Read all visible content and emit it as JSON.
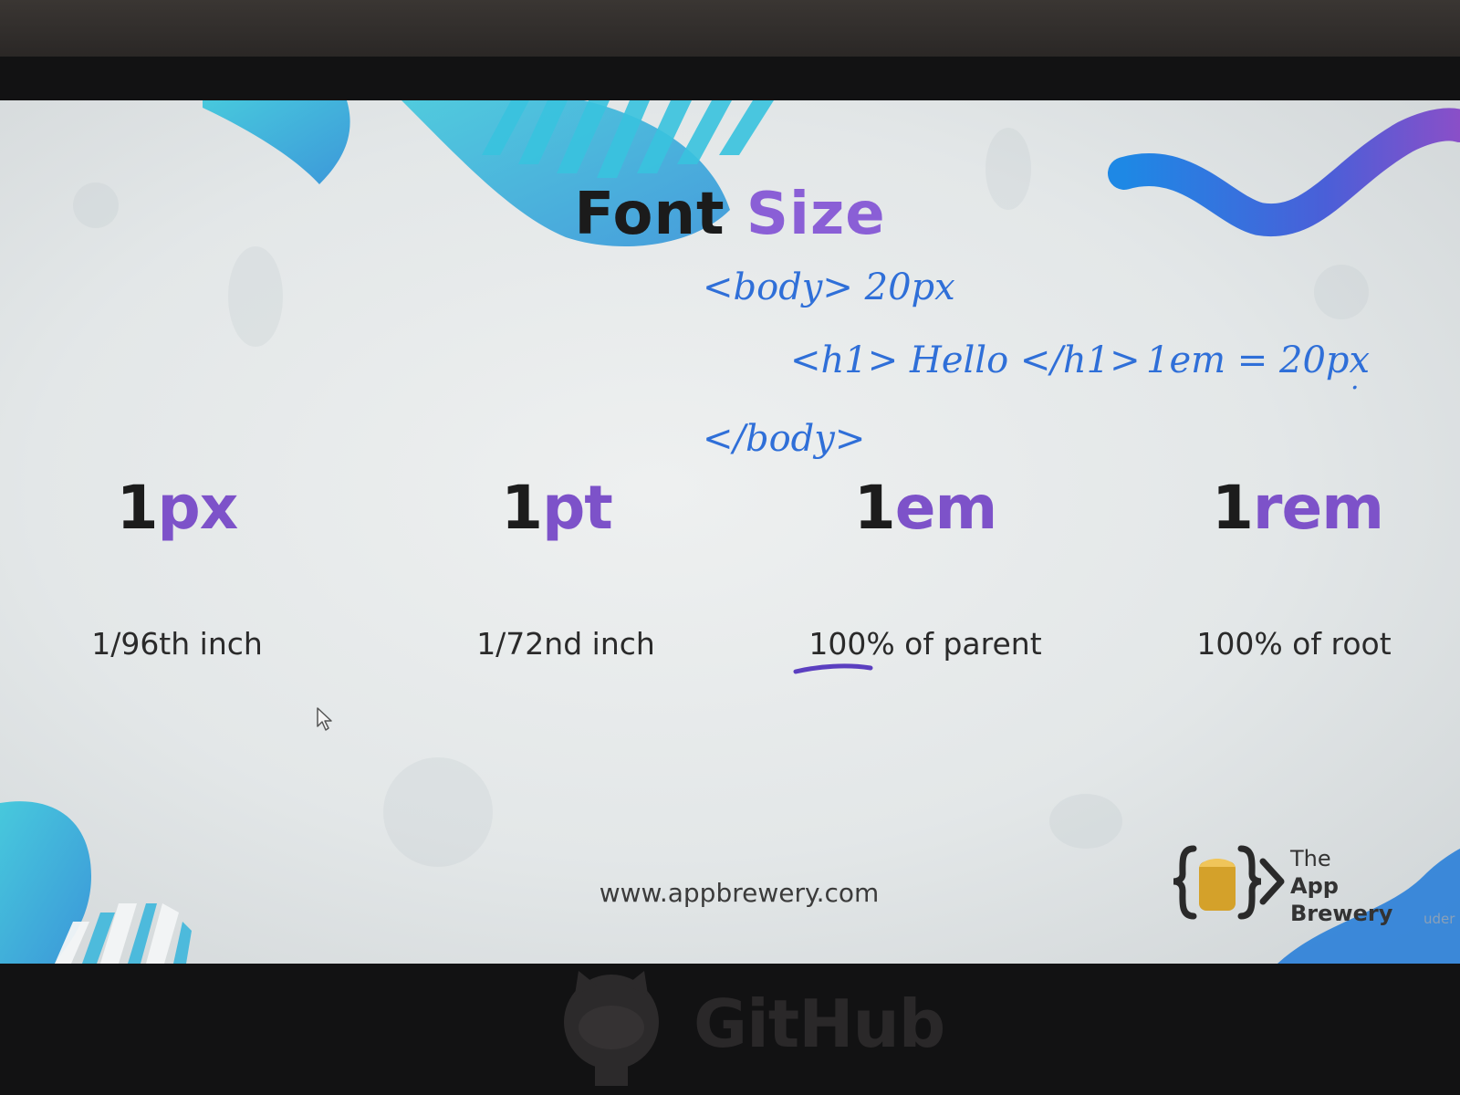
{
  "slide": {
    "title_main": "Font",
    "title_accent": "Size",
    "units": [
      {
        "number": "1",
        "suffix": "px",
        "description": "1/96th inch"
      },
      {
        "number": "1",
        "suffix": "pt",
        "description": "1/72nd inch"
      },
      {
        "number": "1",
        "suffix": "em",
        "description": "100% of parent"
      },
      {
        "number": "1",
        "suffix": "rem",
        "description": "100% of root"
      }
    ],
    "footer_url": "www.appbrewery.com",
    "logo_line1": "The",
    "logo_line2": "App Brewery",
    "corner_text": "uder"
  },
  "annotations": {
    "line1": "<body> 20px",
    "line2": "<h1> Hello </h1>",
    "line2_note": "1em = 20px",
    "line3": "</body>"
  },
  "stand": {
    "brand_text": "GitHub"
  },
  "colors": {
    "accent_purple": "#8a5fd6",
    "ink_blue": "#2f6fd8",
    "teal": "#2bb5d6"
  },
  "icons": {
    "logo": "app-brewery-braces-icon",
    "cursor": "mouse-pointer-icon",
    "stand": "github-octocat-icon"
  }
}
